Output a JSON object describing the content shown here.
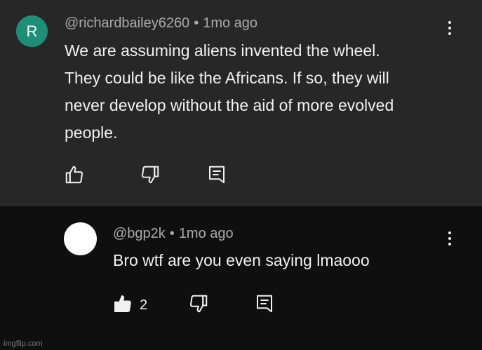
{
  "comments": [
    {
      "avatar_letter": "R",
      "avatar_color": "#1e8f77",
      "author": "@richardbailey6260",
      "separator": "•",
      "time": "1mo ago",
      "text_lines": [
        "We are assuming aliens invented the wheel.",
        "They could be like the Africans. If so, they will",
        "never develop without the aid of more evolved",
        "people."
      ],
      "like_count": null
    },
    {
      "avatar_color": "#ffffff",
      "author": "@bgp2k",
      "separator": "•",
      "time": "1mo ago",
      "text": "Bro wtf are you even saying lmaooo",
      "like_count": "2"
    }
  ],
  "icons": {
    "like": "thumbs-up-icon",
    "dislike": "thumbs-down-icon",
    "reply": "reply-icon",
    "more": "more-vert-icon"
  },
  "colors": {
    "top_bg": "#272727",
    "bottom_bg": "#0f0f0f",
    "text": "#f1f1f1",
    "meta": "#aaaaaa"
  },
  "watermark": "imgflip.com"
}
